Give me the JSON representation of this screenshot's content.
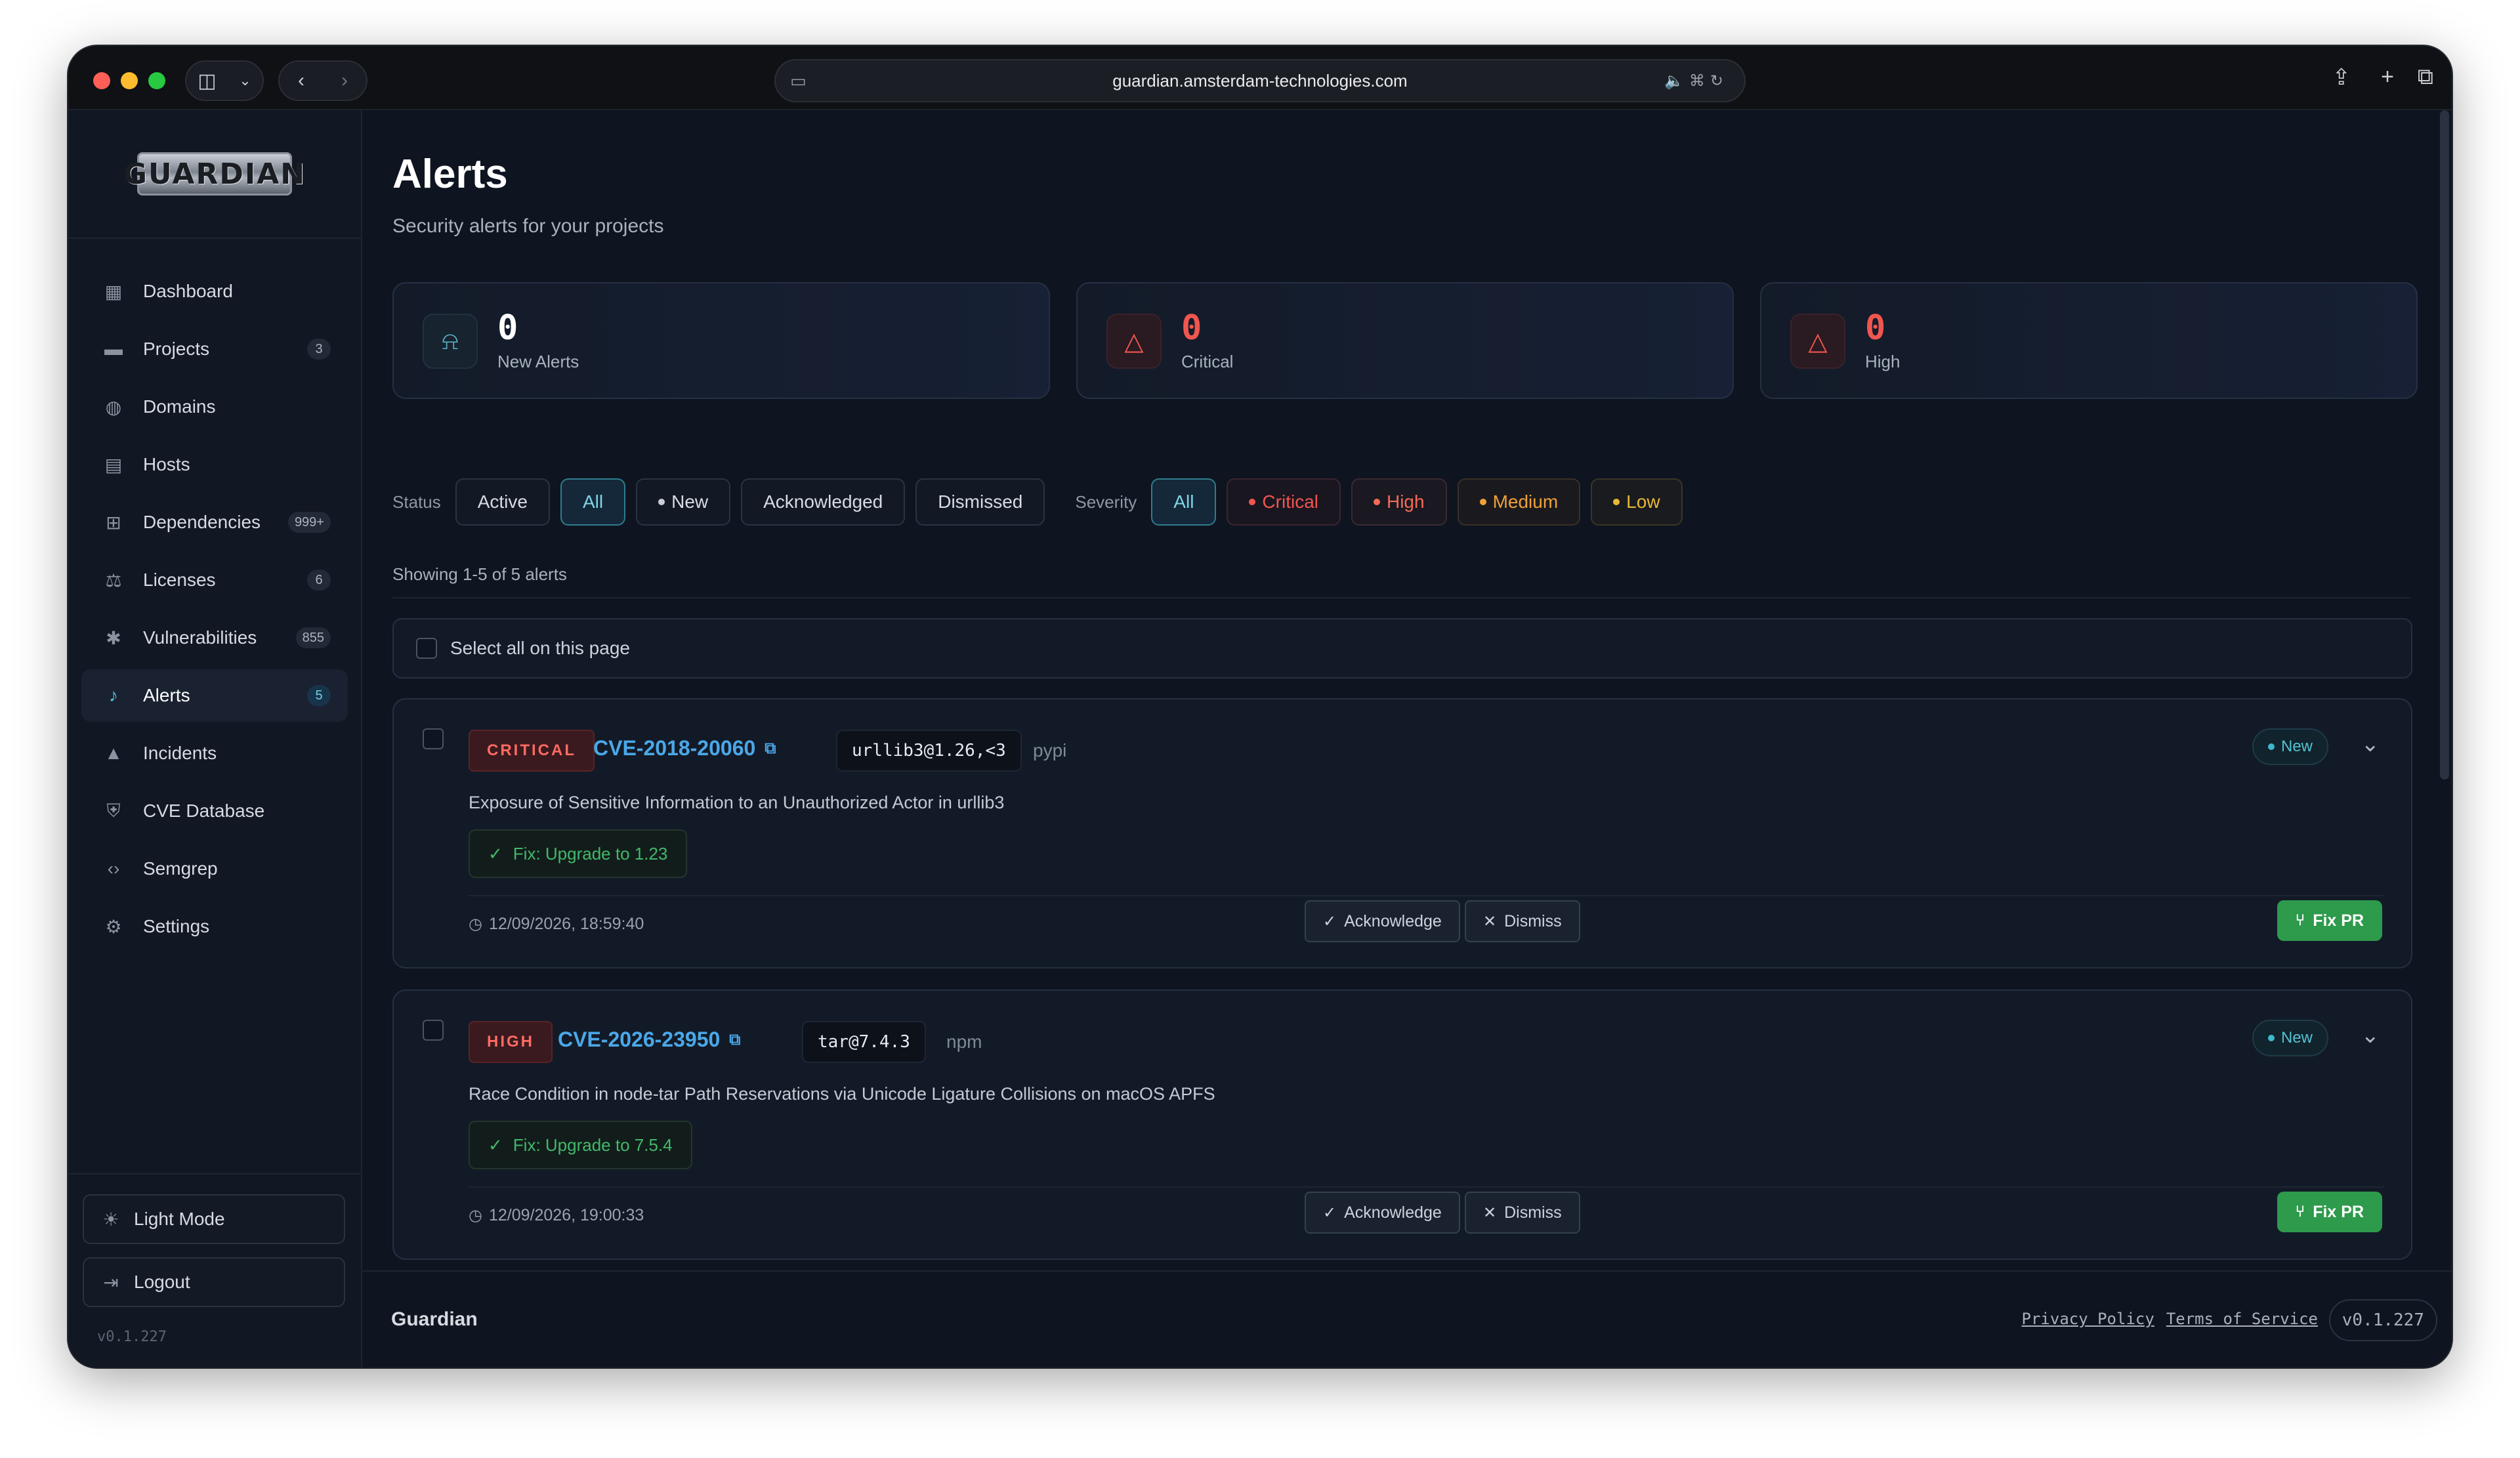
{
  "browser": {
    "url": "guardian.amsterdam-technologies.com"
  },
  "sidebar": {
    "logo_text": "GUARDIAN",
    "items": [
      {
        "label": "Dashboard",
        "icon": "dashboard-icon",
        "glyph": "▦",
        "badge": ""
      },
      {
        "label": "Projects",
        "icon": "folder-icon",
        "glyph": "▬",
        "badge": "3"
      },
      {
        "label": "Domains",
        "icon": "globe-icon",
        "glyph": "◍",
        "badge": ""
      },
      {
        "label": "Hosts",
        "icon": "server-icon",
        "glyph": "▤",
        "badge": ""
      },
      {
        "label": "Dependencies",
        "icon": "dependencies-icon",
        "glyph": "⊞",
        "badge": "999+"
      },
      {
        "label": "Licenses",
        "icon": "gavel-icon",
        "glyph": "⚖",
        "badge": "6"
      },
      {
        "label": "Vulnerabilities",
        "icon": "bug-icon",
        "glyph": "✱",
        "badge": "855"
      },
      {
        "label": "Alerts",
        "icon": "bell-icon",
        "glyph": "♪",
        "badge": "5",
        "active": true
      },
      {
        "label": "Incidents",
        "icon": "warning-icon",
        "glyph": "▲",
        "badge": ""
      },
      {
        "label": "CVE Database",
        "icon": "shield-icon",
        "glyph": "⛨",
        "badge": ""
      },
      {
        "label": "Semgrep",
        "icon": "code-icon",
        "glyph": "‹›",
        "badge": ""
      },
      {
        "label": "Settings",
        "icon": "gear-icon",
        "glyph": "⚙",
        "badge": ""
      }
    ],
    "light_mode_label": "Light Mode",
    "logout_label": "Logout",
    "version": "v0.1.227"
  },
  "page": {
    "title": "Alerts",
    "subtitle": "Security alerts for your projects"
  },
  "stats": [
    {
      "value": "0",
      "label": "New Alerts",
      "icon": "bell-icon",
      "tone": "info"
    },
    {
      "value": "0",
      "label": "Critical",
      "icon": "warning-icon",
      "tone": "danger"
    },
    {
      "value": "0",
      "label": "High",
      "icon": "warning-icon",
      "tone": "danger"
    }
  ],
  "filters": {
    "status_label": "Status",
    "status_options": [
      "Active",
      "All",
      "New",
      "Acknowledged",
      "Dismissed"
    ],
    "status_selected": "All",
    "severity_label": "Severity",
    "severity_options": [
      "All",
      "Critical",
      "High",
      "Medium",
      "Low"
    ],
    "severity_selected": "All"
  },
  "list": {
    "showing_text": "Showing 1-5 of 5 alerts",
    "select_all_label": "Select all on this page"
  },
  "alerts": [
    {
      "severity": "CRITICAL",
      "cve": "CVE-2018-20060",
      "package": "urllib3@1.26,<3",
      "ecosystem": "pypi",
      "status": "New",
      "description": "Exposure of Sensitive Information to an Unauthorized Actor in urllib3",
      "fix": "Fix: Upgrade to 1.23",
      "timestamp": "12/09/2026, 18:59:40",
      "acknowledge_label": "Acknowledge",
      "dismiss_label": "Dismiss",
      "fix_pr_label": "Fix PR"
    },
    {
      "severity": "HIGH",
      "cve": "CVE-2026-23950",
      "package": "tar@7.4.3",
      "ecosystem": "npm",
      "status": "New",
      "description": "Race Condition in node-tar Path Reservations via Unicode Ligature Collisions on macOS APFS",
      "fix": "Fix: Upgrade to 7.5.4",
      "timestamp": "12/09/2026, 19:00:33",
      "acknowledge_label": "Acknowledge",
      "dismiss_label": "Dismiss",
      "fix_pr_label": "Fix PR"
    }
  ],
  "footer": {
    "brand": "Guardian",
    "privacy": "Privacy Policy",
    "terms": "Terms of Service",
    "version": "v0.1.227"
  },
  "colors": {
    "background": "#0e1420",
    "accent": "#4fc3d6",
    "critical": "#f0564f",
    "link": "#4aa8e8",
    "success": "#2e9a4b"
  }
}
